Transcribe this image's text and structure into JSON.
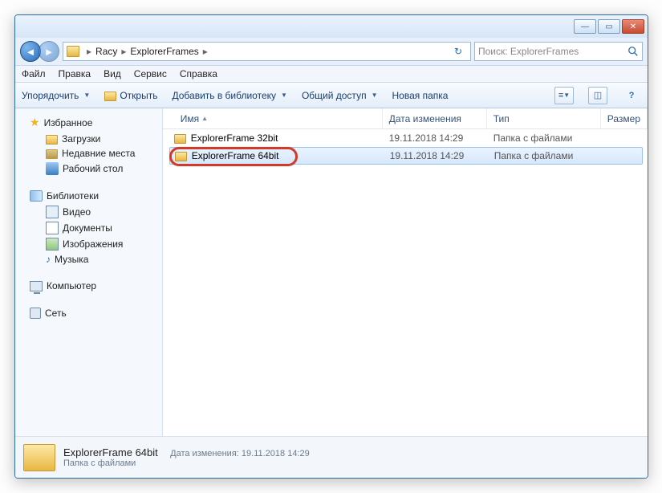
{
  "breadcrumb": {
    "root": "Racy",
    "current": "ExplorerFrames"
  },
  "search": {
    "placeholder": "Поиск: ExplorerFrames"
  },
  "menu": {
    "file": "Файл",
    "edit": "Правка",
    "view": "Вид",
    "tools": "Сервис",
    "help": "Справка"
  },
  "toolbar": {
    "organize": "Упорядочить",
    "open": "Открыть",
    "add_lib": "Добавить в библиотеку",
    "share": "Общий доступ",
    "new_folder": "Новая папка"
  },
  "sidebar": {
    "favorites": "Избранное",
    "fav_items": [
      "Загрузки",
      "Недавние места",
      "Рабочий стол"
    ],
    "libraries": "Библиотеки",
    "lib_items": [
      "Видео",
      "Документы",
      "Изображения",
      "Музыка"
    ],
    "computer": "Компьютер",
    "network": "Сеть"
  },
  "columns": {
    "name": "Имя",
    "date": "Дата изменения",
    "type": "Тип",
    "size": "Размер"
  },
  "rows": [
    {
      "name": "ExplorerFrame 32bit",
      "date": "19.11.2018 14:29",
      "type": "Папка с файлами",
      "selected": false
    },
    {
      "name": "ExplorerFrame 64bit",
      "date": "19.11.2018 14:29",
      "type": "Папка с файлами",
      "selected": true
    }
  ],
  "details": {
    "name": "ExplorerFrame 64bit",
    "type": "Папка с файлами",
    "date_label": "Дата изменения:",
    "date": "19.11.2018 14:29"
  }
}
